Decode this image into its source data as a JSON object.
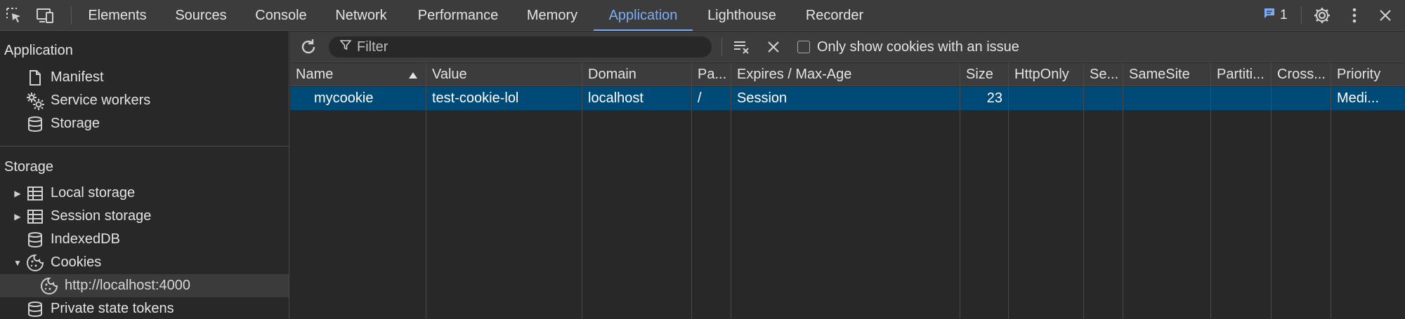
{
  "toolbar": {
    "tabs": [
      {
        "label": "Elements"
      },
      {
        "label": "Sources"
      },
      {
        "label": "Console"
      },
      {
        "label": "Network"
      },
      {
        "label": "Performance"
      },
      {
        "label": "Memory"
      },
      {
        "label": "Application",
        "active": true
      },
      {
        "label": "Lighthouse"
      },
      {
        "label": "Recorder"
      }
    ],
    "issues_count": "1",
    "accent_color": "#7cacf8"
  },
  "sidebar": {
    "application_title": "Application",
    "application_items": [
      {
        "label": "Manifest",
        "icon": "document-icon"
      },
      {
        "label": "Service workers",
        "icon": "gears-icon"
      },
      {
        "label": "Storage",
        "icon": "database-icon"
      }
    ],
    "storage_title": "Storage",
    "storage_items": [
      {
        "label": "Local storage",
        "icon": "table-icon",
        "expandable": true
      },
      {
        "label": "Session storage",
        "icon": "table-icon",
        "expandable": true
      },
      {
        "label": "IndexedDB",
        "icon": "database-icon"
      },
      {
        "label": "Cookies",
        "icon": "cookie-icon",
        "expanded": true
      },
      {
        "label": "http://localhost:4000",
        "icon": "cookie-icon",
        "selected": true
      },
      {
        "label": "Private state tokens",
        "icon": "database-icon"
      }
    ]
  },
  "filterbar": {
    "filter_placeholder": "Filter",
    "issue_checkbox_label": "Only show cookies with an issue"
  },
  "table": {
    "columns": [
      "Name",
      "Value",
      "Domain",
      "Pa...",
      "Expires / Max-Age",
      "Size",
      "HttpOnly",
      "Se...",
      "SameSite",
      "Partiti...",
      "Cross...",
      "Priority"
    ],
    "rows": [
      {
        "name": "mycookie",
        "value": "test-cookie-lol",
        "domain": "localhost",
        "path": "/",
        "expires": "Session",
        "size": "23",
        "httponly": "",
        "secure": "",
        "samesite": "",
        "partition": "",
        "cross": "",
        "priority": "Medi..."
      }
    ],
    "selected_row_color": "#004a77"
  }
}
